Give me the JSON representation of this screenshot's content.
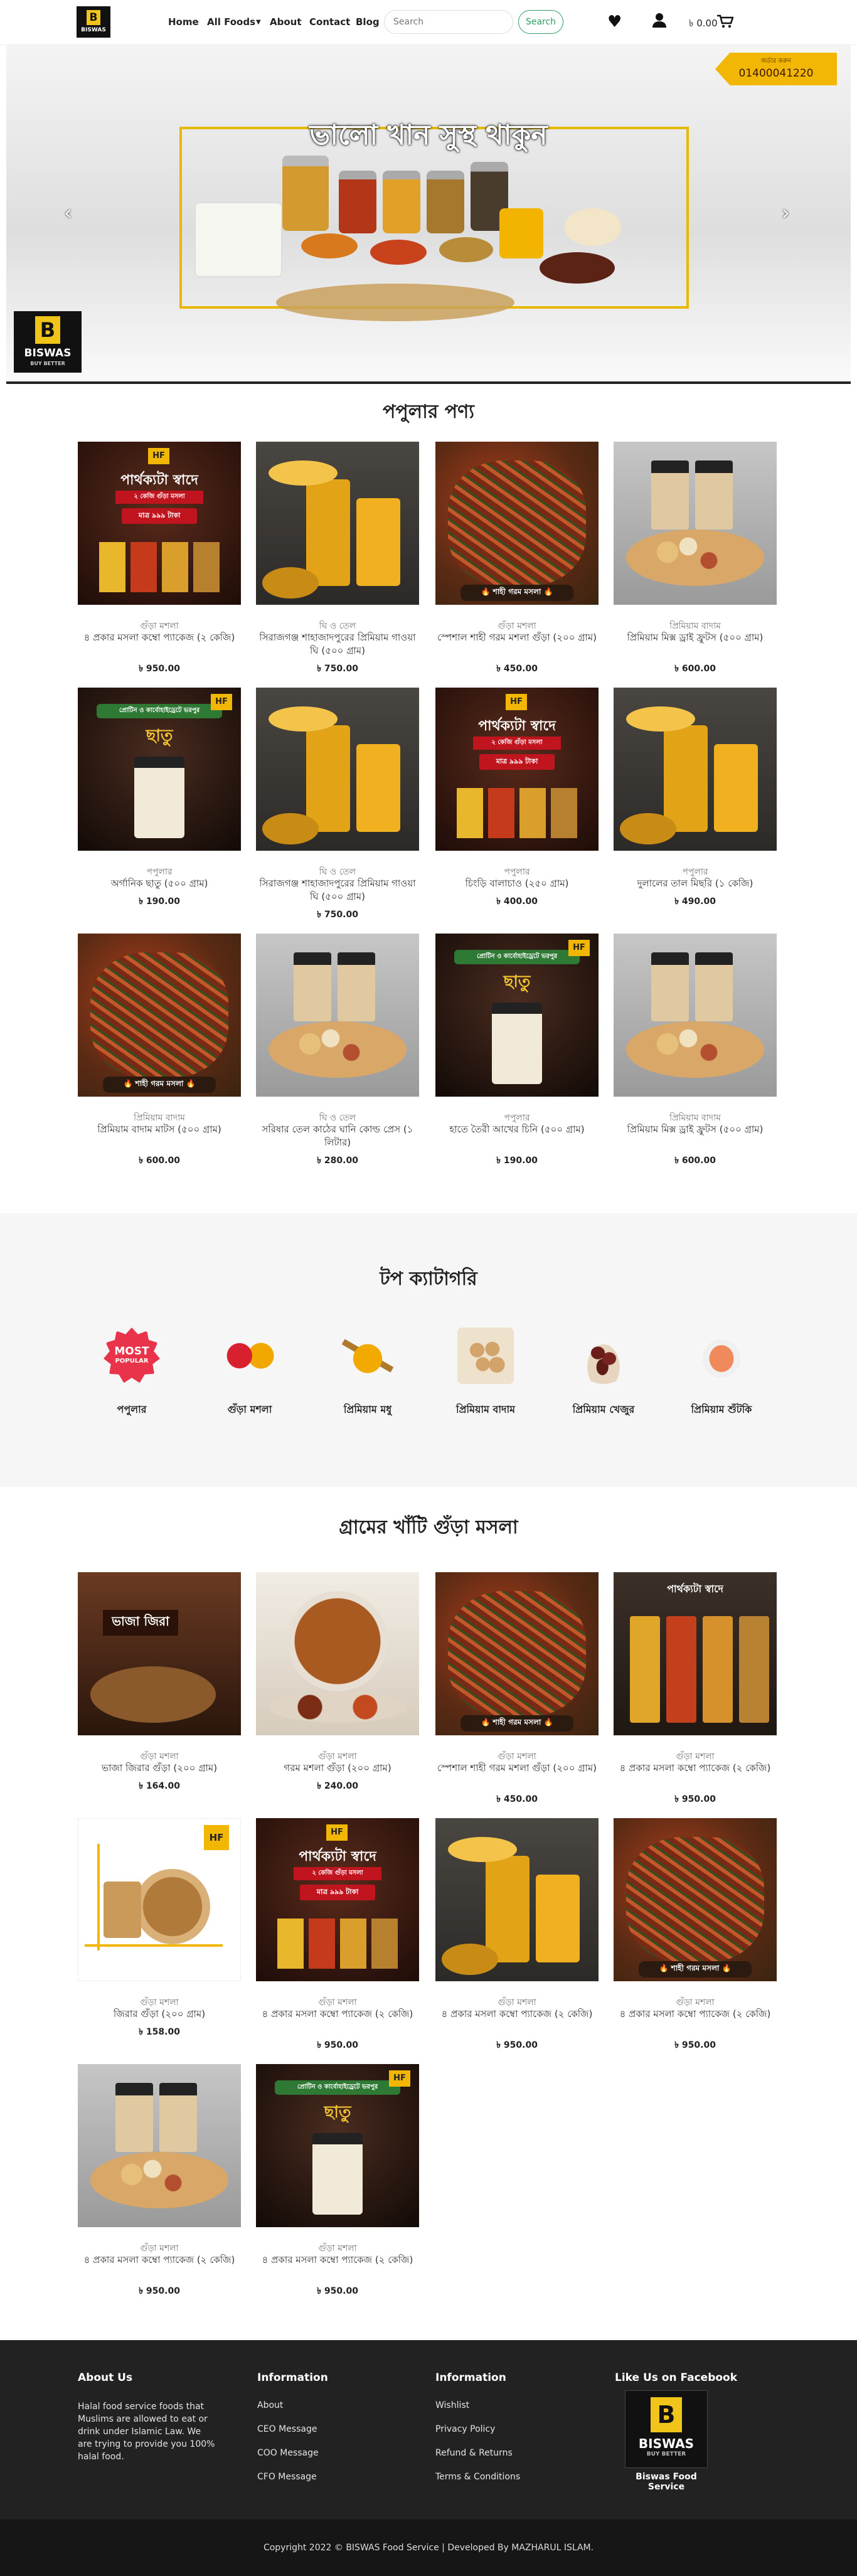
{
  "header": {
    "logo_text": "BISWAS",
    "nav": {
      "home": "Home",
      "all_foods": "All Foods",
      "about": "About",
      "contact": "Contact",
      "blog": "Blog"
    },
    "search": {
      "placeholder": "Search",
      "button_label": "Search"
    },
    "cart_amount": "৳ 0.00",
    "icons": [
      "heart-icon",
      "user-icon",
      "cart-icon",
      "chevron-down-icon"
    ]
  },
  "hero": {
    "title": "ভালো খান সুস্থ থাকুন",
    "ribbon_label": "অর্ডার করুন",
    "ribbon_phone": "01400041220",
    "logo_text": "BISWAS",
    "logo_sub": "BUY BETTER",
    "prev_label": "‹",
    "next_label": "›"
  },
  "popular": {
    "title": "পপুলার পণ্য",
    "products": [
      {
        "category": "গুঁড়া মশলা",
        "name": "৪ প্রকার মসলা কম্বো প্যাকেজ (২ কেজি)",
        "price": "৳ 950.00"
      },
      {
        "category": "ঘি ও তেল",
        "name": "সিরাজগঞ্জ শাহাজাদপুরের প্রিমিয়াম গাওয়া ঘি (৫০০ গ্রাম)",
        "price": "৳ 750.00"
      },
      {
        "category": "গুঁড়া মশলা",
        "name": "স্পেশাল শাহী গরম মশলা গুঁড়া (২০০ গ্রাম)",
        "price": "৳ 450.00"
      },
      {
        "category": "প্রিমিয়াম বাদাম",
        "name": "প্রিমিয়াম মিক্স ড্রাই ফ্রুটস (৫০০ গ্রাম)",
        "price": "৳ 600.00"
      },
      {
        "category": "পপুলার",
        "name": "অর্গানিক ছাতু (৫০০ গ্রাম)",
        "price": "৳ 190.00"
      },
      {
        "category": "ঘি ও তেল",
        "name": "সিরাজগঞ্জ শাহাজাদপুরের প্রিমিয়াম গাওয়া ঘি (৫০০ গ্রাম)",
        "price": "৳ 750.00"
      },
      {
        "category": "পপুলার",
        "name": "চিংড়ি বালাচাও (২৫০ গ্রাম)",
        "price": "৳ 400.00"
      },
      {
        "category": "পপুলার",
        "name": "দুলালের তাল মিছরি (১ কেজি)",
        "price": "৳ 490.00"
      },
      {
        "category": "প্রিমিয়াম বাদাম",
        "name": "প্রিমিয়াম বাদাম মাটস (৫০০ গ্রাম)",
        "price": "৳ 600.00"
      },
      {
        "category": "ঘি ও তেল",
        "name": "সরিষার তেল কাঠের ঘানি কোল্ড প্রেস (১ লিটার)",
        "price": "৳ 280.00"
      },
      {
        "category": "পপুলার",
        "name": "হাতে তৈরী আখের চিনি (৫০০ গ্রাম)",
        "price": "৳ 190.00"
      },
      {
        "category": "প্রিমিয়াম বাদাম",
        "name": "প্রিমিয়াম মিক্স ড্রাই ফ্রুটস (৫০০ গ্রাম)",
        "price": "৳ 600.00"
      }
    ]
  },
  "overlays": {
    "combo_title": "পার্থক্যটা স্বাদে",
    "combo_sub": "২ কেজি গুঁড়া মসলা",
    "combo_price": "মাত্র ৯৯৯ টাকা",
    "garam_badge": "🔥 শাহী গরম মসলা 🔥",
    "chatu_top": "প্রোটিন ও কার্বোহাইড্রেটে ভরপুর",
    "chatu_title": "ছাতু",
    "cumin_title": "ভাজা জিরা",
    "hf_badge": "HF"
  },
  "categories": {
    "title": "টপ ক্যাটাগরি",
    "items": [
      {
        "label": "পপুলার",
        "badge_line1": "MOST",
        "badge_line2": "POPULAR"
      },
      {
        "label": "গুঁড়া মশলা"
      },
      {
        "label": "প্রিমিয়াম মধু"
      },
      {
        "label": "প্রিমিয়াম বাদাম"
      },
      {
        "label": "প্রিমিয়াম খেজুর"
      },
      {
        "label": "প্রিমিয়াম শুঁটকি"
      }
    ]
  },
  "spices": {
    "title": "গ্রামের খাঁটি গুঁড়া মসলা",
    "products": [
      {
        "category": "গুঁড়া মশলা",
        "name": "ভাজা জিরার গুঁড়া (২০০ গ্রাম)",
        "price": "৳ 164.00"
      },
      {
        "category": "গুঁড়া মশলা",
        "name": "গরম মশলা গুঁড়া (২০০ গ্রাম)",
        "price": "৳ 240.00"
      },
      {
        "category": "গুঁড়া মশলা",
        "name": "স্পেশাল শাহী গরম মশলা গুঁড়া (২০০ গ্রাম)",
        "price": "৳ 450.00"
      },
      {
        "category": "গুঁড়া মশলা",
        "name": "৪ প্রকার মসলা কম্বো প্যাকেজ (২ কেজি)",
        "price": "৳ 950.00"
      },
      {
        "category": "গুঁড়া মশলা",
        "name": "জিরার গুঁড়া (২০০ গ্রাম)",
        "price": "৳ 158.00"
      },
      {
        "category": "গুঁড়া মশলা",
        "name": "৪ প্রকার মসলা কম্বো প্যাকেজ (২ কেজি)",
        "price": "৳ 950.00"
      },
      {
        "category": "গুঁড়া মশলা",
        "name": "৪ প্রকার মসলা কম্বো প্যাকেজ (২ কেজি)",
        "price": "৳ 950.00"
      },
      {
        "category": "গুঁড়া মশলা",
        "name": "৪ প্রকার মসলা কম্বো প্যাকেজ (২ কেজি)",
        "price": "৳ 950.00"
      },
      {
        "category": "গুঁড়া মশলা",
        "name": "৪ প্রকার মসলা কম্বো প্যাকেজ (২ কেজি)",
        "price": "৳ 950.00"
      },
      {
        "category": "গুঁড়া মশলা",
        "name": "৪ প্রকার মসলা কম্বো প্যাকেজ (২ কেজি)",
        "price": "৳ 950.00"
      }
    ]
  },
  "footer": {
    "about": {
      "title": "About Us",
      "text": "Halal food service foods that Muslims are allowed to eat or drink under Islamic Law. We are trying to provide you 100% halal food."
    },
    "information1": {
      "title": "Information",
      "links": [
        "About",
        "CEO Message",
        "COO Message",
        "CFO Message"
      ]
    },
    "information2": {
      "title": "Information",
      "links": [
        "Wishlist",
        "Privacy Policy",
        "Refund & Returns",
        "Terms & Conditions"
      ]
    },
    "facebook": {
      "title": "Like Us on Facebook",
      "logo_text": "BISWAS",
      "logo_sub": "BUY BETTER",
      "caption": "Biswas Food Service"
    },
    "copyright": "Copyright 2022 © BISWAS Food Service | Developed By MAZHARUL ISLAM."
  }
}
